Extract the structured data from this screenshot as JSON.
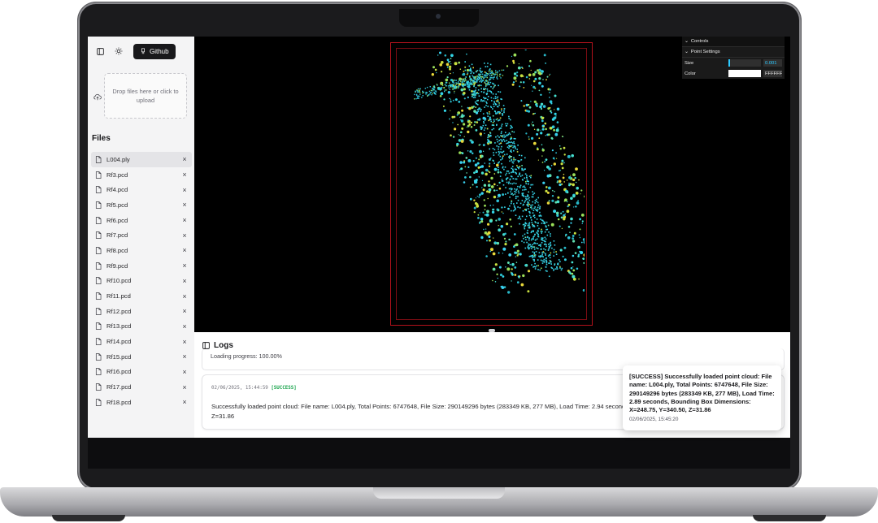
{
  "sidebar": {
    "github_label": "Github",
    "drop_text": "Drop files here or click to upload",
    "files_heading": "Files",
    "files": [
      {
        "name": "L004.ply"
      },
      {
        "name": "Rf3.pcd"
      },
      {
        "name": "Rf4.pcd"
      },
      {
        "name": "Rf5.pcd"
      },
      {
        "name": "Rf6.pcd"
      },
      {
        "name": "Rf7.pcd"
      },
      {
        "name": "Rf8.pcd"
      },
      {
        "name": "Rf9.pcd"
      },
      {
        "name": "Rf10.pcd"
      },
      {
        "name": "Rf11.pcd"
      },
      {
        "name": "Rf12.pcd"
      },
      {
        "name": "Rf13.pcd"
      },
      {
        "name": "Rf14.pcd"
      },
      {
        "name": "Rf15.pcd"
      },
      {
        "name": "Rf16.pcd"
      },
      {
        "name": "Rf17.pcd"
      },
      {
        "name": "Rf18.pcd"
      }
    ],
    "remove_glyph": "×"
  },
  "controls": {
    "title": "Controls",
    "section": "Point Settings",
    "size_label": "Size",
    "size_value": "0.001",
    "size_fraction": 0.05,
    "color_label": "Color",
    "color_value": "FFFFFF"
  },
  "logs": {
    "title": "Logs",
    "progress_text": "Loading progress: 100.00%",
    "entry": {
      "timestamp": "02/06/2025, 15:44:59",
      "level": "[SUCCESS]",
      "message": "Successfully loaded point cloud: File name: L004.ply, Total Points: 6747648, File Size: 290149296 bytes (283349 KB, 277 MB), Load Time: 2.94 seconds, Z=31.86"
    }
  },
  "toast": {
    "message": "[SUCCESS] Successfully loaded point cloud: File name: L004.ply, Total Points: 6747648, File Size: 290149296 bytes (283349 KB, 277 MB), Load Time: 2.89 seconds, Bounding Box Dimensions: X=248.75, Y=340.50, Z=31.86",
    "time": "02/06/2025, 15:45:20"
  },
  "colors": {
    "accent": "#2cc9ff",
    "success": "#16a34a",
    "bbox": "#b3121c"
  },
  "icons": {
    "sidebar_toggle": "panel-left-icon",
    "theme": "sun-icon",
    "github": "github-icon",
    "upload": "cloud-upload-icon",
    "file": "file-icon",
    "logs": "panel-icon"
  }
}
